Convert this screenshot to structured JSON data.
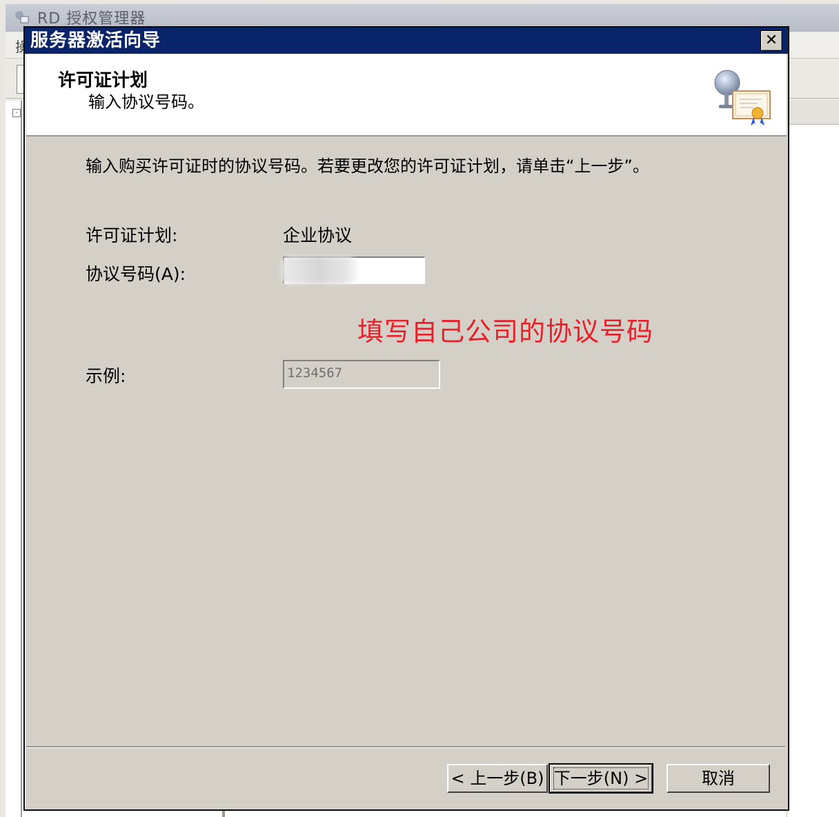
{
  "background_window": {
    "title": "RD 授权管理器",
    "menu_first": "操"
  },
  "dialog": {
    "title": "服务器激活向导",
    "close_glyph": "✕",
    "header": {
      "title": "许可证计划",
      "subtitle": "输入协议号码。",
      "icon": "license-certificate-icon"
    },
    "instruction": "输入购买许可证时的协议号码。若要更改您的许可证计划，请单击“上一步”。",
    "license_plan_label": "许可证计划:",
    "license_plan_value": "企业协议",
    "agreement_label": "协议号码(A):",
    "agreement_value": "",
    "annotation": "填写自己公司的协议号码",
    "example_label": "示例:",
    "example_value": "1234567",
    "buttons": {
      "back": "< 上一步(B)",
      "next": "下一步(N) >",
      "cancel": "取消"
    }
  },
  "colors": {
    "titlebar": "#0a246a",
    "dialog_bg": "#d4d0c8",
    "annotation": "#e8202a"
  }
}
